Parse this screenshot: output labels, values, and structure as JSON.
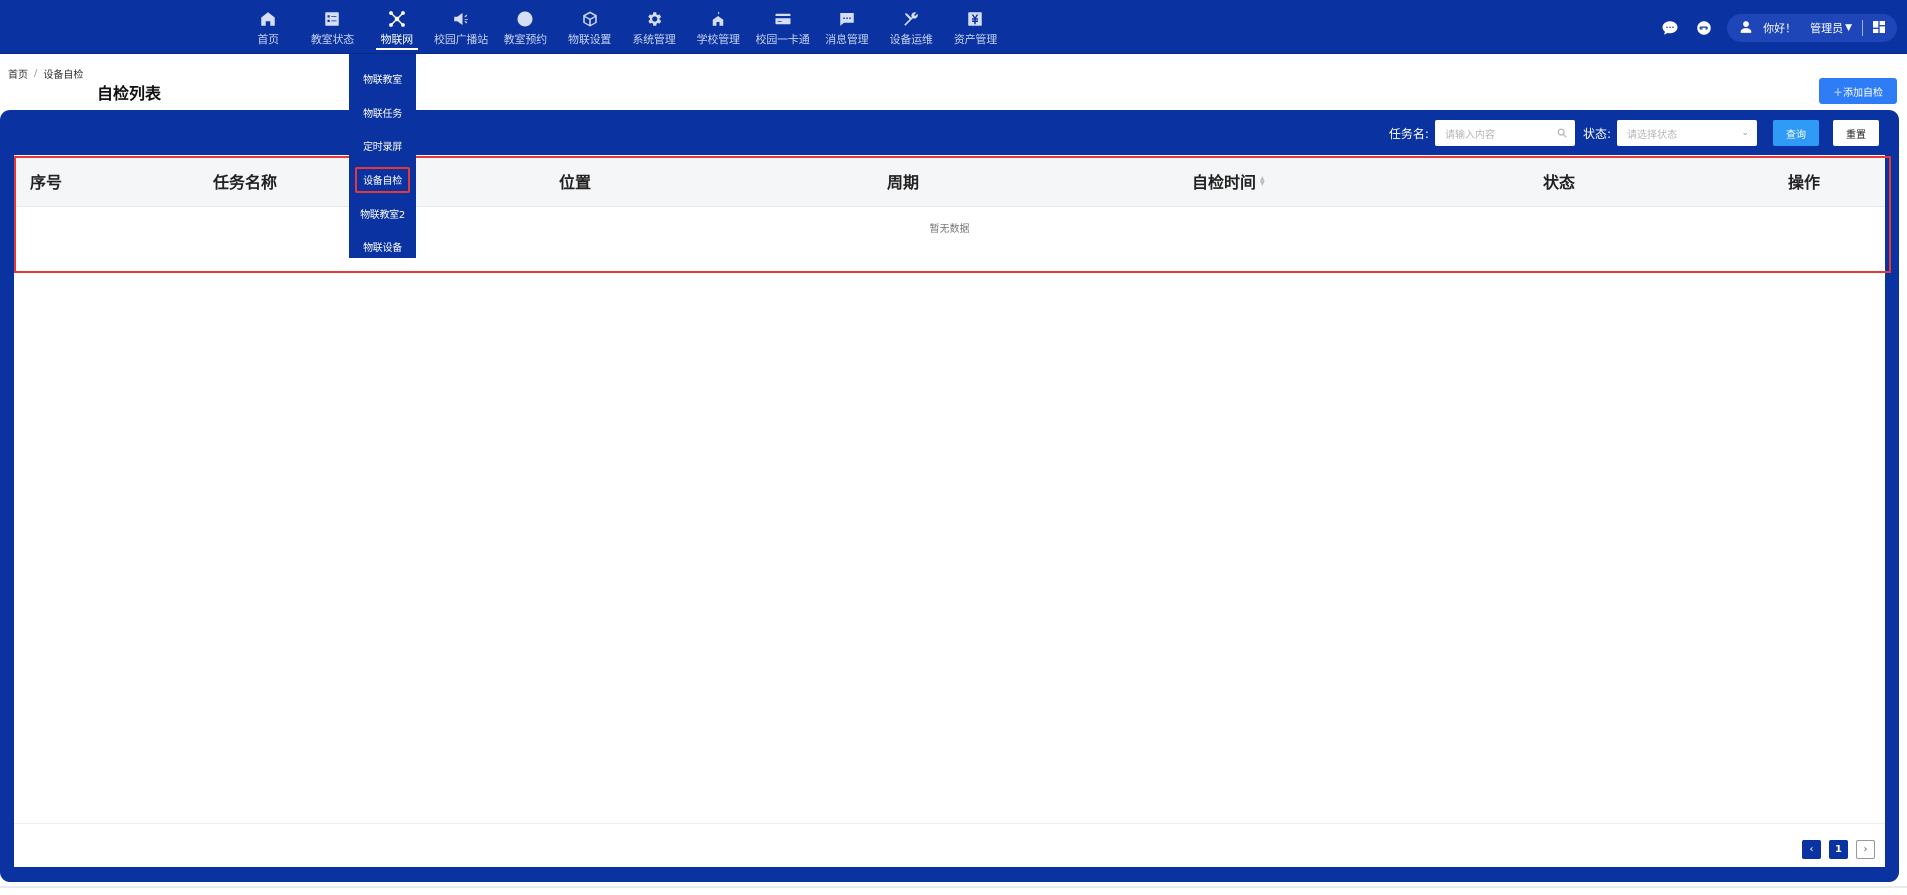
{
  "nav": {
    "items": [
      {
        "label": "首页",
        "icon": "home-icon"
      },
      {
        "label": "教室状态",
        "icon": "checklist-icon"
      },
      {
        "label": "物联网",
        "icon": "network-icon"
      },
      {
        "label": "校园广播站",
        "icon": "megaphone-icon"
      },
      {
        "label": "教室预约",
        "icon": "clock-icon"
      },
      {
        "label": "物联设置",
        "icon": "cube-icon"
      },
      {
        "label": "系统管理",
        "icon": "gear-icon"
      },
      {
        "label": "学校管理",
        "icon": "school-icon"
      },
      {
        "label": "校园一卡通",
        "icon": "card-icon"
      },
      {
        "label": "消息管理",
        "icon": "message-icon"
      },
      {
        "label": "设备运维",
        "icon": "tools-icon"
      },
      {
        "label": "资产管理",
        "icon": "yen-icon"
      }
    ],
    "active": "物联网"
  },
  "dropdown": {
    "items": [
      "物联教室",
      "物联任务",
      "定时录屏",
      "设备自检",
      "物联教室2",
      "物联设备"
    ],
    "highlighted": "设备自检"
  },
  "user": {
    "hello": "你好！",
    "name": "管理员"
  },
  "breadcrumb": {
    "home": "首页",
    "separator": "/",
    "current": "设备自检"
  },
  "page": {
    "title": "自检列表",
    "add_button": "＋添加自检"
  },
  "filter": {
    "task_label": "任务名:",
    "task_placeholder": "请输入内容",
    "status_label": "状态:",
    "status_placeholder": "请选择状态",
    "query_button": "查询",
    "reset_button": "重置"
  },
  "table": {
    "columns": [
      "序号",
      "任务名称",
      "位置",
      "周期",
      "自检时间",
      "状态",
      "操作"
    ],
    "rows": [],
    "empty_text": "暂无数据"
  },
  "pagination": {
    "current_page": "1",
    "prev": "‹",
    "next": "›"
  },
  "colors": {
    "primary": "#0a32a0",
    "accent": "#2f7df6",
    "highlight": "#e53935"
  }
}
